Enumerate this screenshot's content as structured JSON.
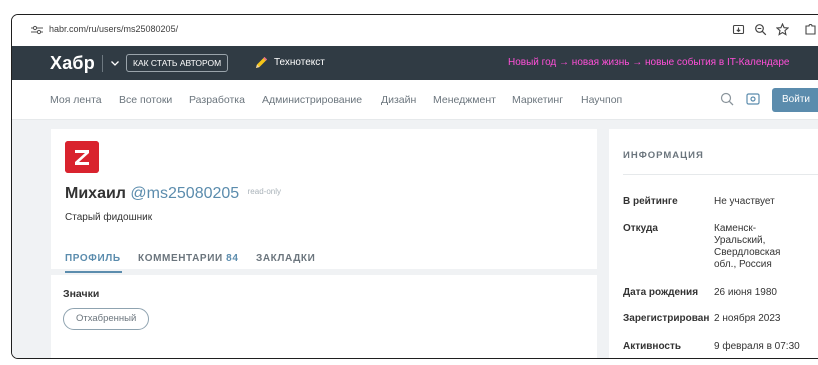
{
  "browser": {
    "url": "habr.com/ru/users/ms25080205/",
    "icons": [
      "site-settings-icon",
      "install-app-icon",
      "zoom-icon",
      "bookmark-star-icon",
      "extensions-icon"
    ]
  },
  "topbar": {
    "logo": "Хабр",
    "author_button": "КАК СТАТЬ АВТОРОМ",
    "technotext_label": "Технотекст",
    "promo": "Новый год → новая жизнь → новые события в IT-Календаре"
  },
  "nav": {
    "items": [
      "Моя лента",
      "Все потоки",
      "Разработка",
      "Администрирование",
      "Дизайн",
      "Менеджмент",
      "Маркетинг",
      "Научпоп"
    ],
    "login_button": "Войти"
  },
  "profile": {
    "real_name": "Михаил",
    "nickname": "@ms25080205",
    "read_only": "read-only",
    "status": "Старый фидошник",
    "tabs": {
      "profile": "ПРОФИЛЬ",
      "comments": "КОММЕНТАРИИ",
      "comments_count": "84",
      "bookmarks": "ЗАКЛАДКИ"
    }
  },
  "badges": {
    "title": "Значки",
    "items": [
      "Отхабренный"
    ]
  },
  "info": {
    "title": "ИНФОРМАЦИЯ",
    "rows": [
      {
        "key": "В рейтинге",
        "value": "Не участвует"
      },
      {
        "key": "Откуда",
        "value": "Каменск-Уральский, Свердловская обл., Россия"
      },
      {
        "key": "Дата рождения",
        "value": "26 июня 1980"
      },
      {
        "key": "Зарегистрирован",
        "value": "2 ноября 2023"
      },
      {
        "key": "Активность",
        "value": "9 февраля в 07:30"
      }
    ]
  },
  "colors": {
    "topbar_bg": "#303b44",
    "accent": "#5b8cad",
    "promo": "#ff4fd8",
    "avatar": "#d9232e"
  }
}
